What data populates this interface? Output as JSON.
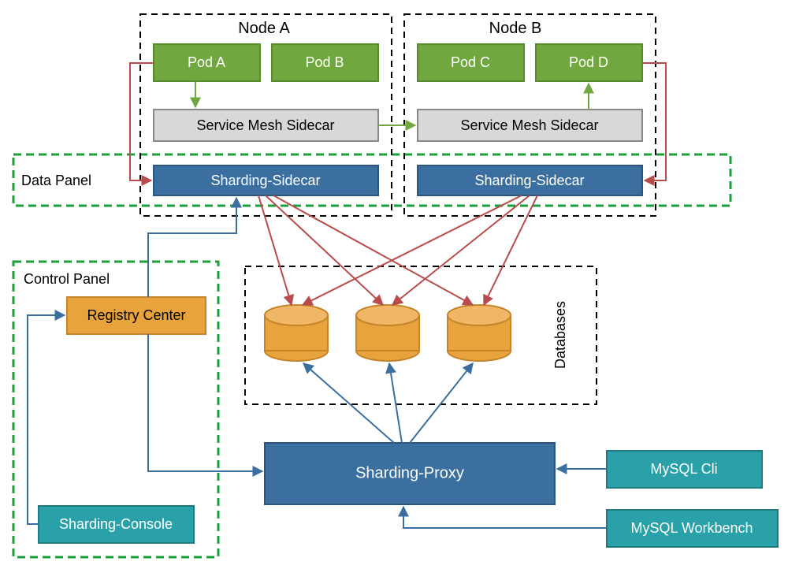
{
  "data_panel_label": "Data Panel",
  "control_panel_label": "Control Panel",
  "databases_label": "Databases",
  "node_a": {
    "title": "Node A",
    "pod_left": "Pod A",
    "pod_right": "Pod B",
    "sidecar": "Service Mesh Sidecar",
    "sharding_sidecar": "Sharding-Sidecar"
  },
  "node_b": {
    "title": "Node B",
    "pod_left": "Pod C",
    "pod_right": "Pod D",
    "sidecar": "Service Mesh Sidecar",
    "sharding_sidecar": "Sharding-Sidecar"
  },
  "registry_center": "Registry Center",
  "sharding_console": "Sharding-Console",
  "sharding_proxy": "Sharding-Proxy",
  "mysql_cli": "MySQL Cli",
  "mysql_workbench": "MySQL Workbench",
  "colors": {
    "green_box_fill": "#70a83f",
    "green_box_stroke": "#5a8a30",
    "grey_box_fill": "#d8d8d8",
    "grey_box_stroke": "#888",
    "blue_box_fill": "#3b6fa0",
    "blue_box_stroke": "#2d567d",
    "teal_box_fill": "#2aa0a8",
    "teal_box_stroke": "#1f7b81",
    "orange_box_fill": "#e8a33d",
    "orange_box_stroke": "#c4842a",
    "db_fill": "#e8a33d",
    "db_stroke": "#c4842a",
    "dashed_black": "#000",
    "dashed_green": "#1a9e3e",
    "arrow_red": "#b84b4b",
    "arrow_blue": "#3b6fa0",
    "arrow_green": "#70a83f"
  }
}
